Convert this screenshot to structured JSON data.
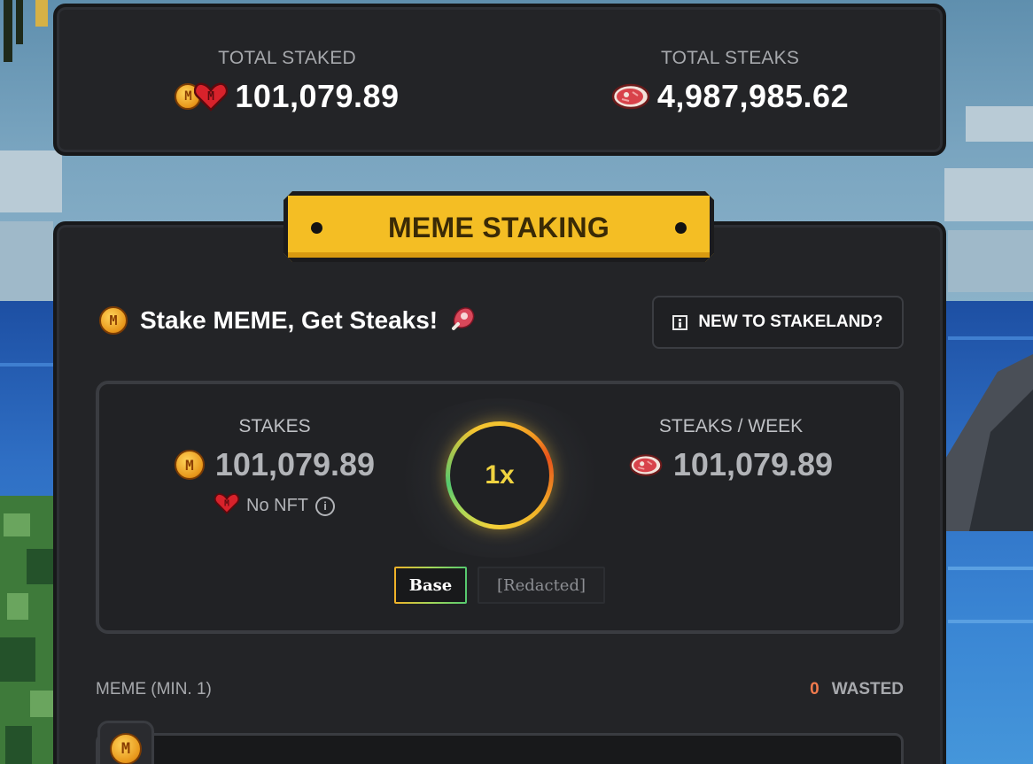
{
  "stats": {
    "total_staked_label": "TOTAL STAKED",
    "total_staked_value": "101,079.89",
    "total_steaks_label": "TOTAL STEAKS",
    "total_steaks_value": "4,987,985.62"
  },
  "banner": {
    "title": "MEME STAKING"
  },
  "headline": {
    "text": "Stake MEME, Get Steaks!"
  },
  "help_button": {
    "label": "NEW TO STAKELAND?"
  },
  "stakes": {
    "label": "STAKES",
    "value": "101,079.89",
    "nft_status": "No NFT"
  },
  "multiplier": {
    "value": "1x"
  },
  "steaks_week": {
    "label": "STEAKS / WEEK",
    "value": "101,079.89"
  },
  "tabs": [
    {
      "label": "Base",
      "active": true
    },
    {
      "label": "[Redacted]",
      "active": false
    }
  ],
  "input": {
    "label": "MEME (MIN. 1)",
    "wasted_count": "0",
    "wasted_label": "WASTED",
    "value": ""
  },
  "colors": {
    "accent_yellow": "#f4be24",
    "panel_bg": "#232427",
    "wasted_orange": "#f07a4d",
    "ring_yellow": "#f0d340"
  },
  "icons": {
    "meme_coin": "meme-coin-icon",
    "heart": "meme-heart-icon",
    "steak": "steak-icon",
    "meat": "meat-emoji-icon",
    "info": "info-icon"
  }
}
